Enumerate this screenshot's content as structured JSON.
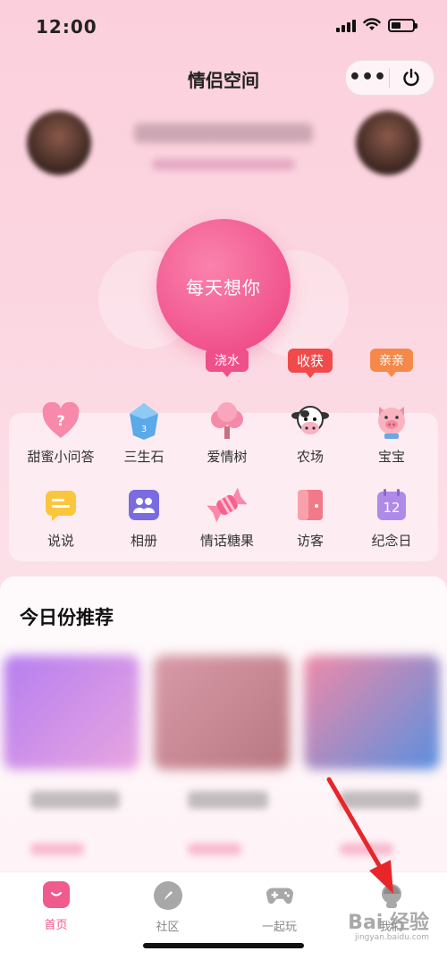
{
  "status_bar": {
    "time": "12:00"
  },
  "nav": {
    "title": "情侣空间",
    "more": "•••"
  },
  "center_button": {
    "label": "每天想你"
  },
  "features": [
    {
      "label": "甜蜜小问答",
      "icon": "heart-question-icon"
    },
    {
      "label": "三生石",
      "icon": "crystal-stone-icon"
    },
    {
      "label": "爱情树",
      "icon": "love-tree-icon",
      "badge": "浇水",
      "badge_color": "#f0508a"
    },
    {
      "label": "农场",
      "icon": "cow-icon",
      "badge": "收获",
      "badge_color": "#f04a4a"
    },
    {
      "label": "宝宝",
      "icon": "pig-icon",
      "badge": "亲亲",
      "badge_color": "#f5894a"
    },
    {
      "label": "说说",
      "icon": "message-icon"
    },
    {
      "label": "相册",
      "icon": "album-icon"
    },
    {
      "label": "情话糖果",
      "icon": "candy-icon"
    },
    {
      "label": "访客",
      "icon": "visitor-door-icon"
    },
    {
      "label": "纪念日",
      "icon": "calendar-icon"
    }
  ],
  "recommend": {
    "title": "今日份推荐"
  },
  "tabs": [
    {
      "label": "首页",
      "icon": "home-icon",
      "active": true
    },
    {
      "label": "社区",
      "icon": "compass-icon",
      "active": false
    },
    {
      "label": "一起玩",
      "icon": "gamepad-icon",
      "active": false
    },
    {
      "label": "我们",
      "icon": "couple-icon",
      "active": false
    }
  ],
  "watermark": {
    "text": "Bai 经验",
    "sub": "jingyan.baidu.com"
  },
  "colors": {
    "accent": "#f05a8c",
    "background": "#fbd6e1"
  }
}
